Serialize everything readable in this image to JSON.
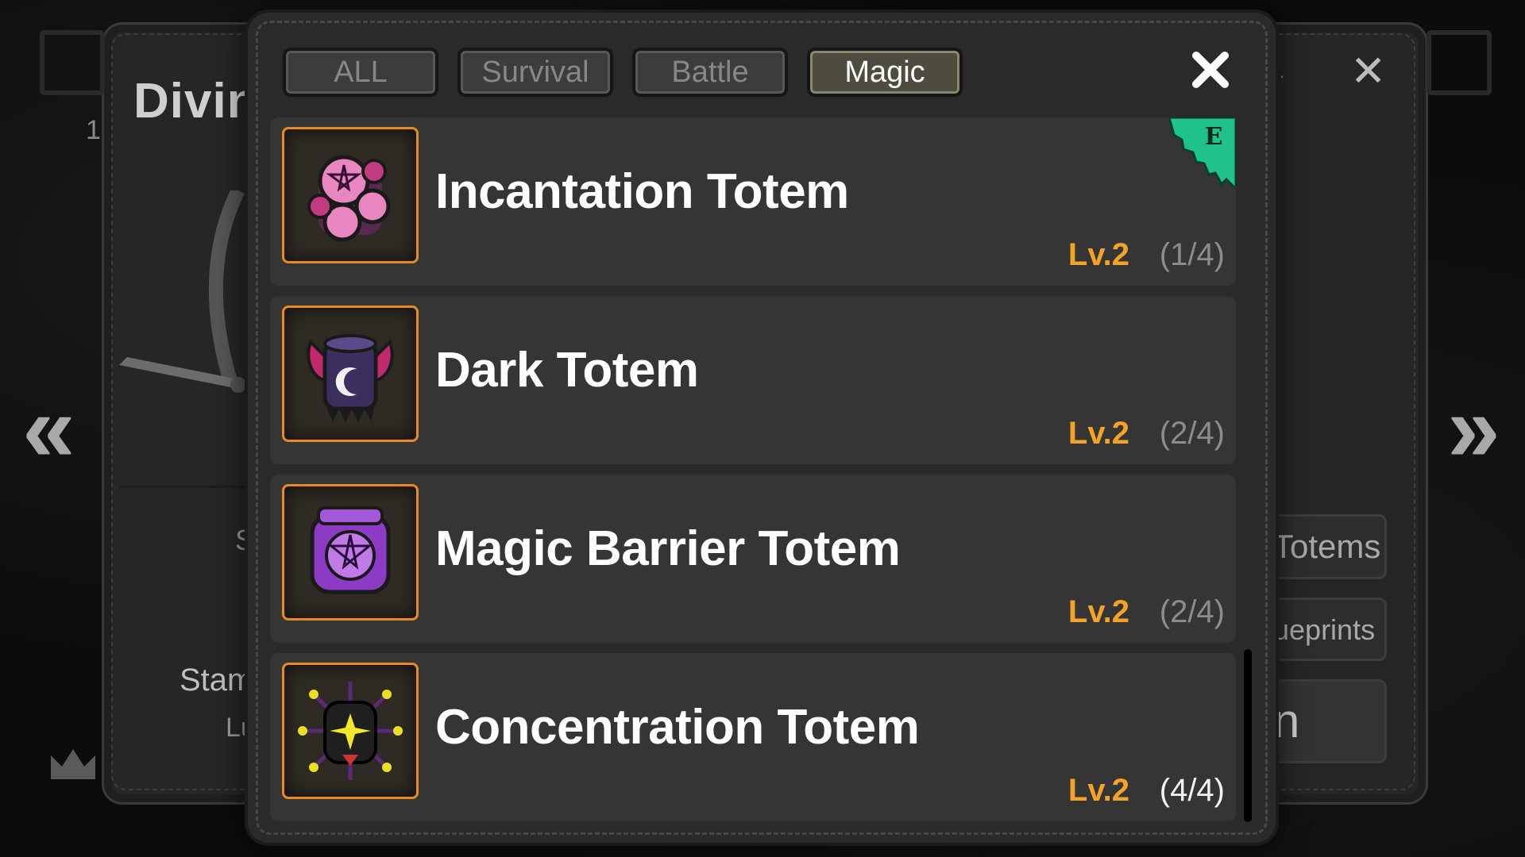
{
  "background": {
    "panel_title": "Divin",
    "panel_number": "1",
    "stat_label_stamina": "Stam",
    "stat_label_lu": "Lu",
    "stat_label_s": "S",
    "side_button_totems": "Totems",
    "side_button_blueprints": "ueprints",
    "side_button_main": "n",
    "dots_text": "s.",
    "left_nav": "«",
    "right_nav": "»"
  },
  "tabs": [
    {
      "label": "ALL",
      "active": false
    },
    {
      "label": "Survival",
      "active": false
    },
    {
      "label": "Battle",
      "active": false
    },
    {
      "label": "Magic",
      "active": true
    }
  ],
  "items": [
    {
      "name": "Incantation Totem",
      "level": "Lv.2",
      "count": "(1/4)",
      "icon": "incantation-totem-icon",
      "badge": "E"
    },
    {
      "name": "Dark Totem",
      "level": "Lv.2",
      "count": "(2/4)",
      "icon": "dark-totem-icon"
    },
    {
      "name": "Magic Barrier Totem",
      "level": "Lv.2",
      "count": "(2/4)",
      "icon": "magic-barrier-totem-icon"
    },
    {
      "name": "Concentration Totem",
      "level": "Lv.2",
      "count": "(4/4)",
      "icon": "concentration-totem-icon",
      "complete": true
    }
  ],
  "colors": {
    "level": "#f3a327",
    "icon_border": "#e88a1e",
    "badge": "#1fc28a",
    "active_tab": "#4d4c3e"
  }
}
